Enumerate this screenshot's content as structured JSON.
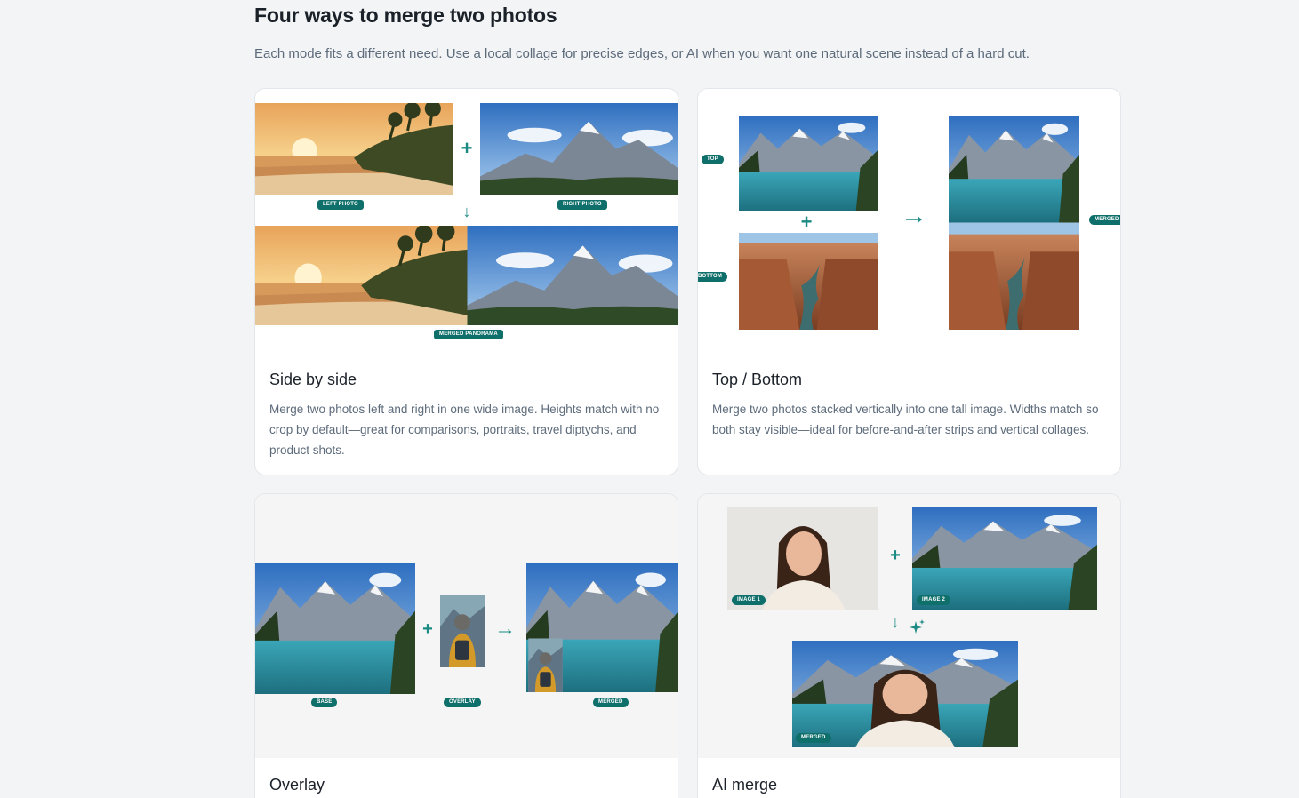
{
  "section": {
    "title": "Four ways to merge two photos",
    "subtitle": "Each mode fits a different need. Use a local collage for precise edges, or AI when you want one natural scene instead of a hard cut."
  },
  "cards": [
    {
      "title": "Side by side",
      "description": "Merge two photos left and right in one wide image. Heights match with no crop by default—great for comparisons, portraits, travel diptychs, and product shots.",
      "labels": {
        "left": "LEFT PHOTO",
        "right": "RIGHT PHOTO",
        "merged": "MERGED PANORAMA"
      }
    },
    {
      "title": "Top / Bottom",
      "description": "Merge two photos stacked vertically into one tall image. Widths match so both stay visible—ideal for before-and-after strips and vertical collages.",
      "labels": {
        "top": "TOP",
        "bottom": "BOTTOM",
        "merged": "MERGED"
      }
    },
    {
      "title": "Overlay",
      "description": "",
      "labels": {
        "base": "BASE",
        "overlay": "OVERLAY",
        "merged": "MERGED"
      }
    },
    {
      "title": "AI merge",
      "description": "",
      "labels": {
        "image1": "IMAGE 1",
        "image2": "IMAGE 2",
        "merged": "MERGED"
      }
    }
  ],
  "colors": {
    "accent": "#0f6f6a",
    "text": "#1b2129",
    "muted": "#5d6b7b",
    "background": "#f3f4f5"
  },
  "icons": {
    "plus": "+",
    "arrow_down": "↓",
    "arrow_right": "→",
    "sparkle": "sparkle-icon"
  }
}
